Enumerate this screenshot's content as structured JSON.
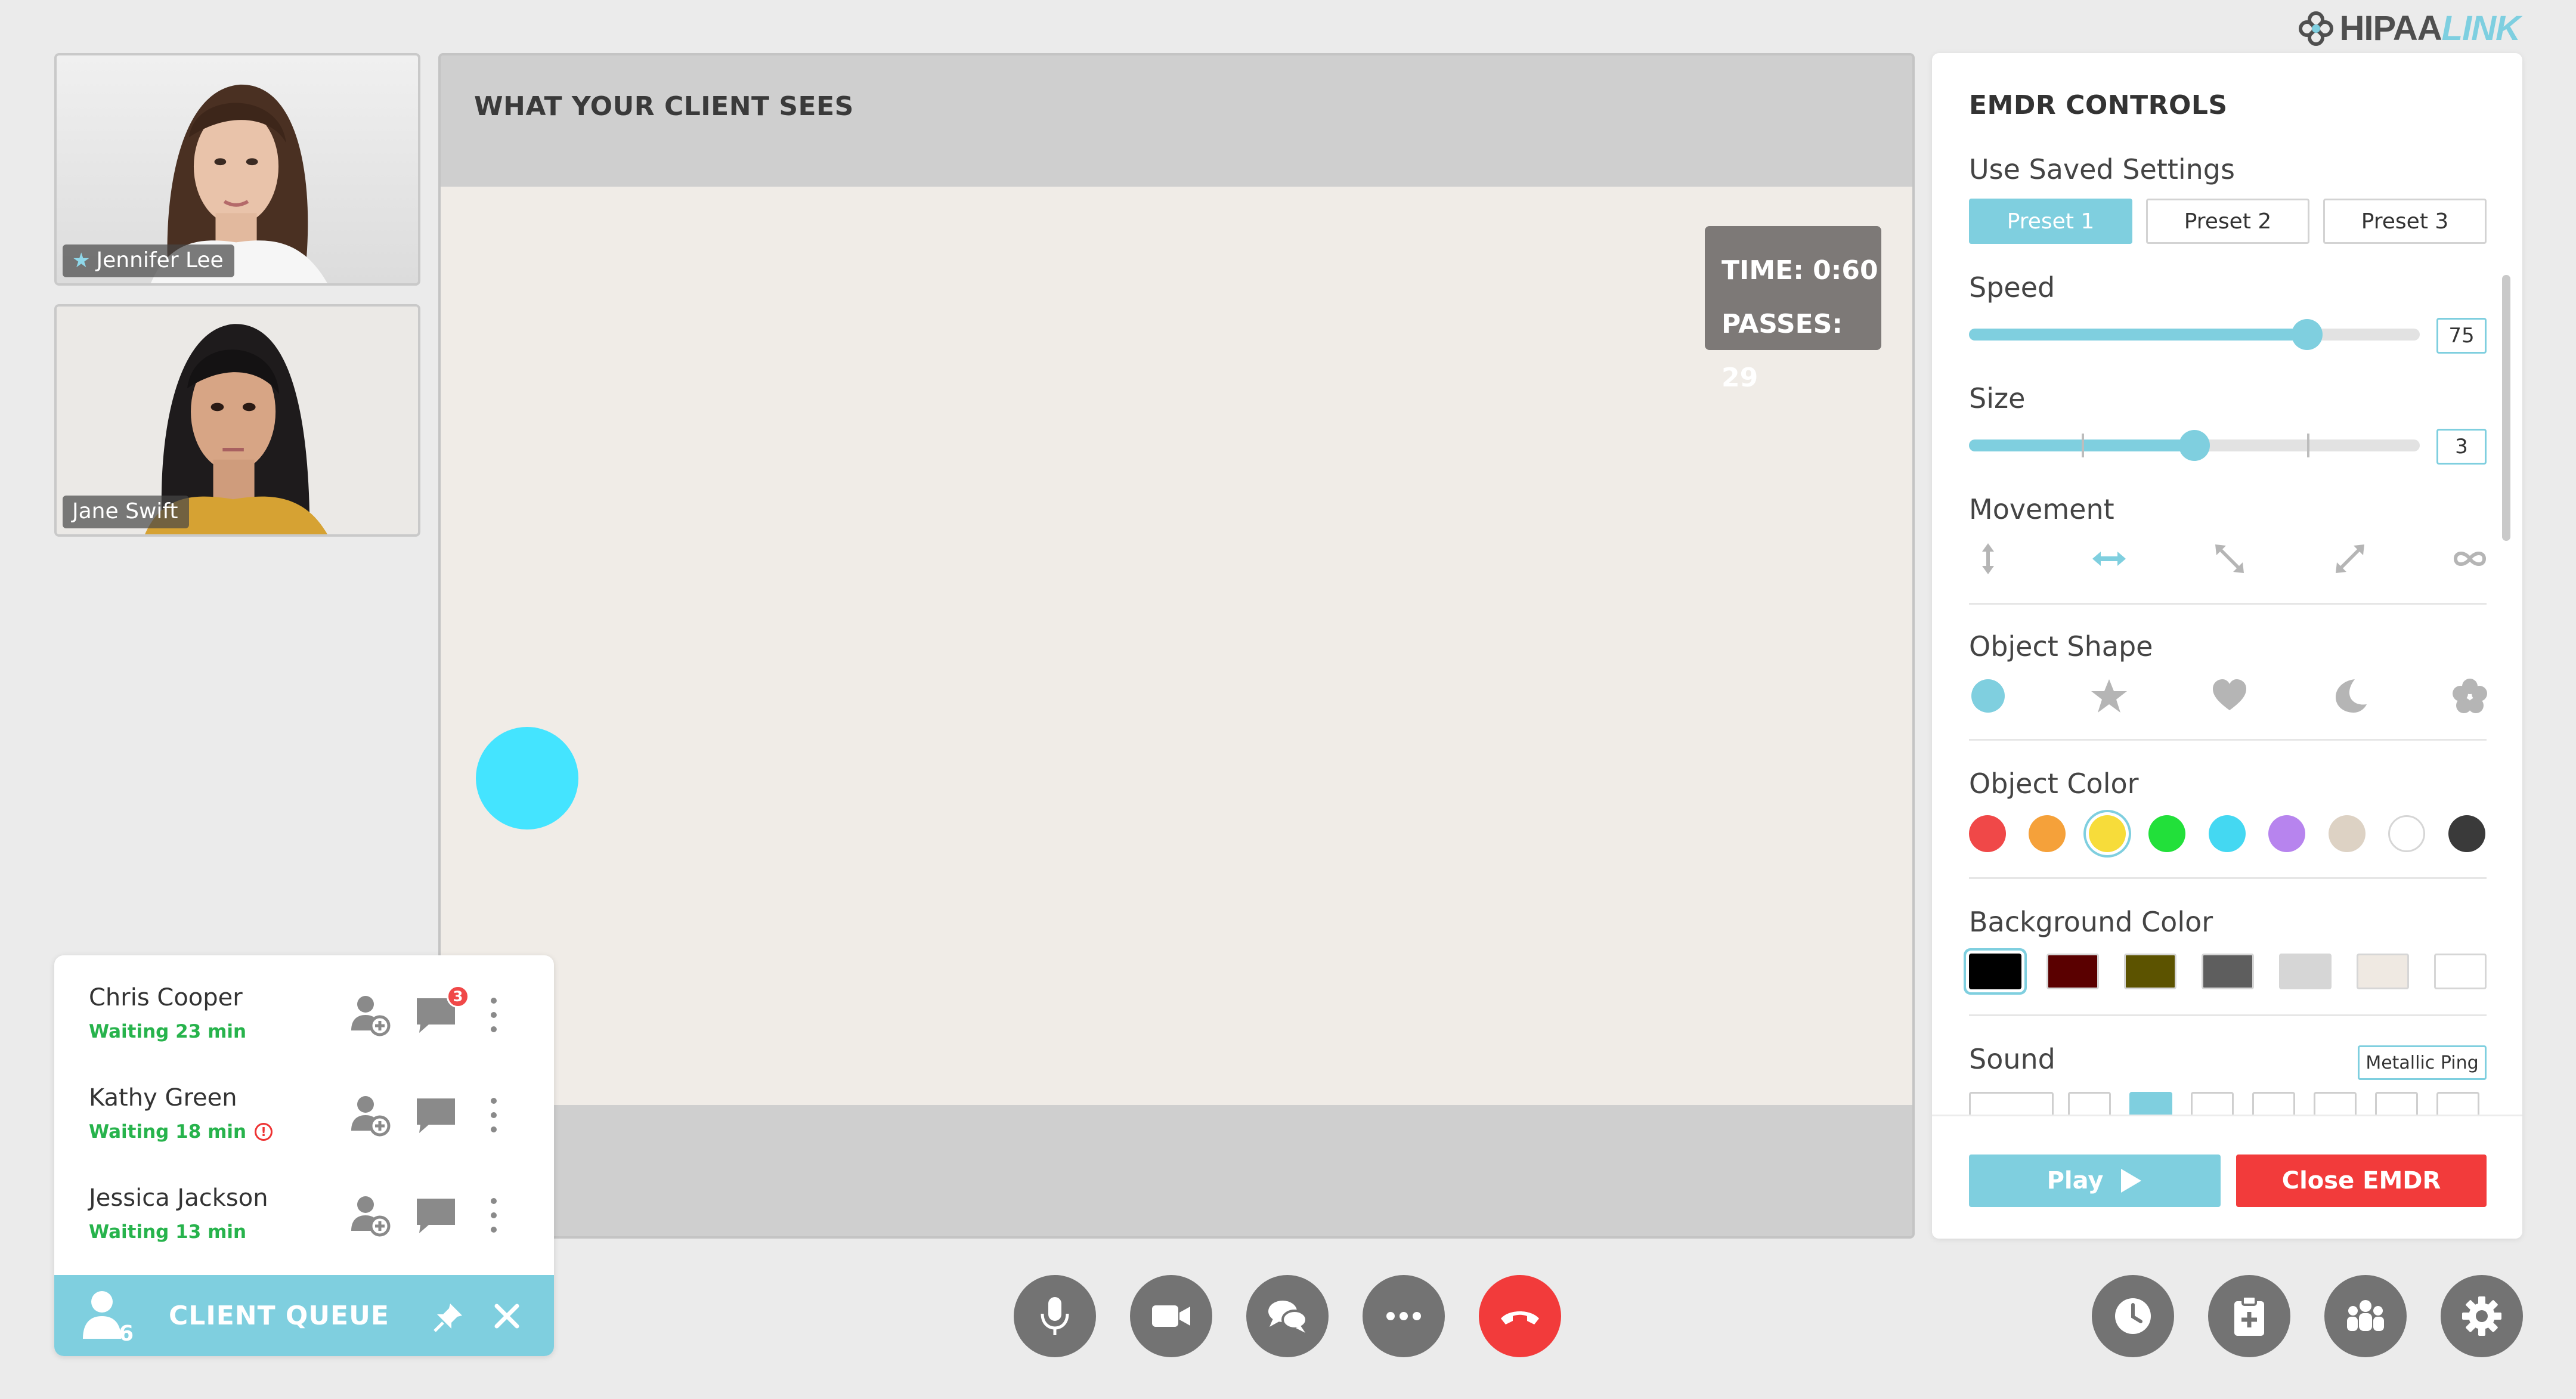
{
  "brand": {
    "name_part1": "HIPAA",
    "name_part2": "LINK",
    "accent": "#7fcfdf"
  },
  "participants": [
    {
      "name": "Jennifer Lee",
      "host": true,
      "icon": "star-icon"
    },
    {
      "name": "Jane Swift",
      "host": false
    }
  ],
  "client_view": {
    "header": "WHAT YOUR CLIENT SEES",
    "time_label": "TIME: 0:60",
    "passes_label": "PASSES: 29",
    "object_color": "#44e4ff",
    "background": "#f0ece7"
  },
  "queue": {
    "title": "CLIENT QUEUE",
    "count": "6",
    "clients": [
      {
        "name": "Chris Cooper",
        "status": "Waiting 23 min",
        "unread": "3",
        "warning": false
      },
      {
        "name": "Kathy Green",
        "status": "Waiting 18 min",
        "unread": "",
        "warning": true
      },
      {
        "name": "Jessica Jackson",
        "status": "Waiting 13 min",
        "unread": "",
        "warning": false
      }
    ]
  },
  "call_controls": [
    "microphone-icon",
    "video-camera-icon",
    "chat-icon",
    "more-icon",
    "hang-up-icon"
  ],
  "side_controls": [
    "clock-icon",
    "clipboard-icon",
    "group-icon",
    "gear-icon"
  ],
  "emdr": {
    "title": "EMDR CONTROLS",
    "saved_settings_label": "Use Saved Settings",
    "presets": [
      "Preset 1",
      "Preset 2",
      "Preset 3"
    ],
    "active_preset": 0,
    "speed_label": "Speed",
    "speed_value": "75",
    "speed_fraction": 0.75,
    "size_label": "Size",
    "size_value": "3",
    "size_fraction": 0.5,
    "movement_label": "Movement",
    "movements": [
      "vertical-arrow-icon",
      "horizontal-arrow-icon",
      "diagonal-down-icon",
      "diagonal-up-icon",
      "infinity-icon"
    ],
    "active_movement": 1,
    "shape_label": "Object Shape",
    "shapes": [
      "circle-icon",
      "star-icon",
      "heart-icon",
      "moon-icon",
      "flower-icon"
    ],
    "active_shape": 0,
    "color_label": "Object Color",
    "colors": [
      "#f04848",
      "#f5a13a",
      "#f7dc3a",
      "#22e03a",
      "#44d8f2",
      "#b784ee",
      "#ddd2c4",
      "#ffffff",
      "#3a3a3a"
    ],
    "active_color": 2,
    "bg_label": "Background Color",
    "bg_colors": [
      "#000000",
      "#5a0000",
      "#5c5300",
      "#5e5e5e",
      "#d6d6d6",
      "#efe9e2",
      "#ffffff"
    ],
    "active_bg": 0,
    "sound_label": "Sound",
    "sound_value": "Metallic Ping",
    "play_label": "Play",
    "close_label": "Close EMDR"
  }
}
